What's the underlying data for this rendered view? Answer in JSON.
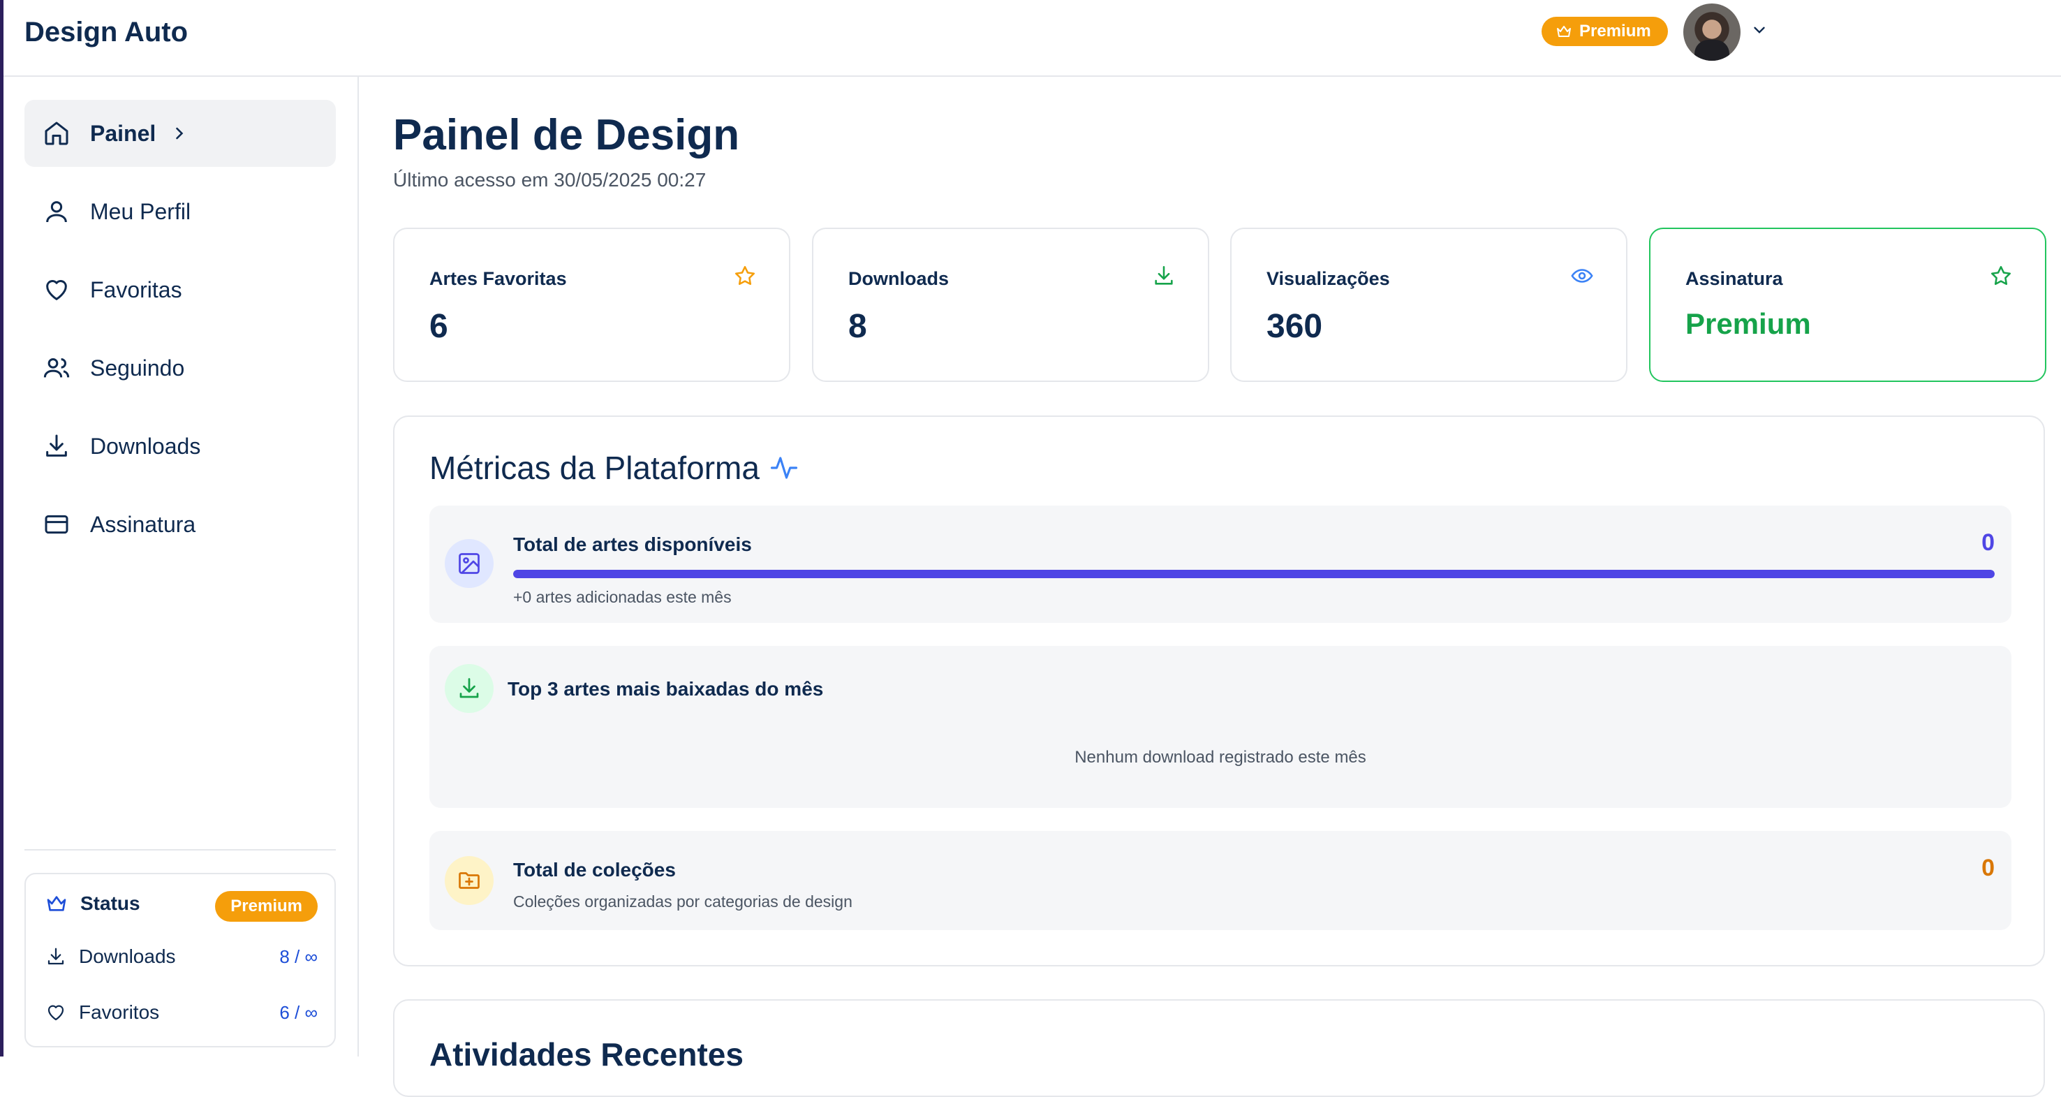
{
  "header": {
    "brand": "Design Auto",
    "badge_label": "Premium"
  },
  "sidebar": {
    "items": [
      {
        "label": "Painel",
        "icon": "home-icon",
        "active": true
      },
      {
        "label": "Meu Perfil",
        "icon": "user-icon"
      },
      {
        "label": "Favoritas",
        "icon": "heart-icon"
      },
      {
        "label": "Seguindo",
        "icon": "users-icon"
      },
      {
        "label": "Downloads",
        "icon": "download-icon"
      },
      {
        "label": "Assinatura",
        "icon": "credit-card-icon"
      }
    ],
    "status": {
      "title": "Status",
      "badge": "Premium",
      "rows": [
        {
          "label": "Downloads",
          "value": "8 / ∞",
          "icon": "download-icon"
        },
        {
          "label": "Favoritos",
          "value": "6 / ∞",
          "icon": "heart-icon"
        }
      ]
    }
  },
  "main": {
    "title": "Painel de Design",
    "subtitle": "Último acesso em 30/05/2025 00:27",
    "stats": [
      {
        "label": "Artes Favoritas",
        "value": "6",
        "icon": "star-icon",
        "color": "#f59e0b"
      },
      {
        "label": "Downloads",
        "value": "8",
        "icon": "download-icon",
        "color": "#16a34a"
      },
      {
        "label": "Visualizações",
        "value": "360",
        "icon": "eye-icon",
        "color": "#3b82f6"
      },
      {
        "label": "Assinatura",
        "value": "Premium",
        "icon": "star-icon",
        "color": "#16a34a"
      }
    ],
    "metrics": {
      "title": "Métricas da Plataforma",
      "available": {
        "title": "Total de artes disponíveis",
        "value": "0",
        "progress": 1.0,
        "sub": "+0 artes adicionadas este mês"
      },
      "top3": {
        "title": "Top 3 artes mais baixadas do mês",
        "empty": "Nenhum download registrado este mês"
      },
      "collections": {
        "title": "Total de coleções",
        "value": "0",
        "sub": "Coleções organizadas por categorias de design"
      }
    },
    "recent_title": "Atividades Recentes"
  },
  "colors": {
    "navy": "#0f2a4f",
    "premium": "#f59e0b",
    "green": "#16a34a",
    "indigo": "#4f46e5",
    "link": "#1d4ed8"
  }
}
